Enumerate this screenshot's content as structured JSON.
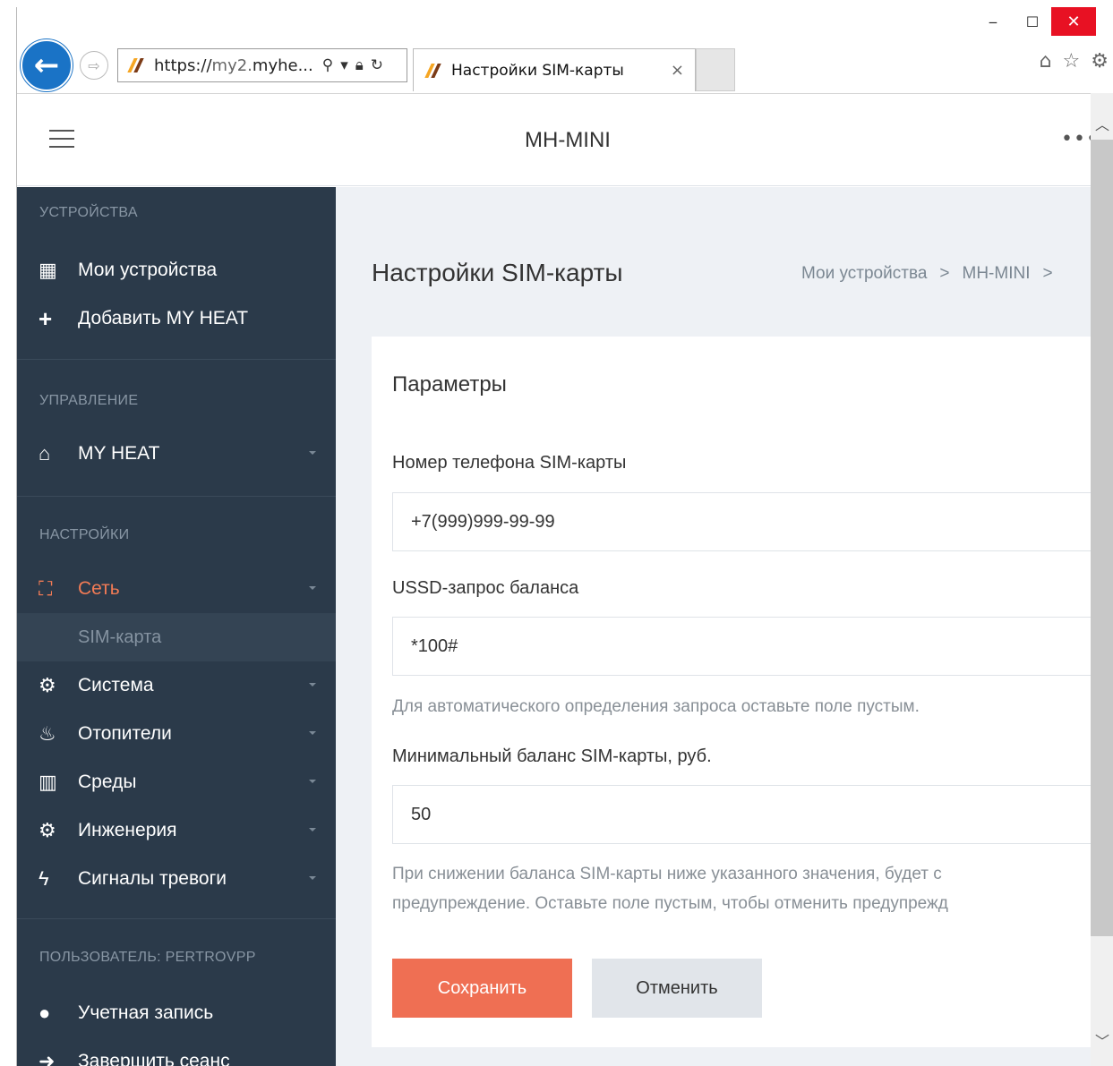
{
  "browser": {
    "url_prefix": "https://",
    "url_host_dim": "my2.",
    "url_host": "myhe...",
    "tab_title": "Настройки SIM-карты",
    "tab_close": "×",
    "window_minimize": "‒",
    "window_maximize": "☐",
    "window_close": "✕"
  },
  "topbar": {
    "title": "MH-MINI",
    "more": "•••"
  },
  "sidebar": {
    "section_devices": "УСТРОЙСТВА",
    "my_devices": "Мои устройства",
    "add_device": "Добавить MY HEAT",
    "section_control": "УПРАВЛЕНИЕ",
    "my_heat": "MY HEAT",
    "section_settings": "НАСТРОЙКИ",
    "network": "Сеть",
    "sim_card": "SIM-карта",
    "system": "Система",
    "heaters": "Отопители",
    "environments": "Среды",
    "engineering": "Инженерия",
    "alarms": "Сигналы тревоги",
    "section_user": "ПОЛЬЗОВАТЕЛЬ: PERTROVPP",
    "account": "Учетная запись",
    "logout": "Завершить сеанс"
  },
  "content": {
    "page_title": "Настройки SIM-карты",
    "breadcrumb": [
      "Мои устройства",
      "MH-MINI"
    ],
    "breadcrumb_sep": ">",
    "card_title": "Параметры",
    "phone_label": "Номер телефона SIM-карты",
    "phone_value": "+7(999)999-99-99",
    "ussd_label": "USSD-запрос баланса",
    "ussd_value": "*100#",
    "ussd_help": "Для автоматического определения запроса оставьте поле пустым.",
    "min_balance_label": "Минимальный баланс SIM-карты, руб.",
    "min_balance_value": "50",
    "min_balance_help_1": "При снижении баланса SIM-карты ниже указанного значения, будет с",
    "min_balance_help_2": "предупреждение. Оставьте поле пустым, чтобы отменить предупрежд",
    "save": "Сохранить",
    "cancel": "Отменить"
  },
  "colors": {
    "sidebar_bg": "#2b3a4a",
    "accent": "#ef6f53",
    "content_bg": "#eef1f5"
  }
}
